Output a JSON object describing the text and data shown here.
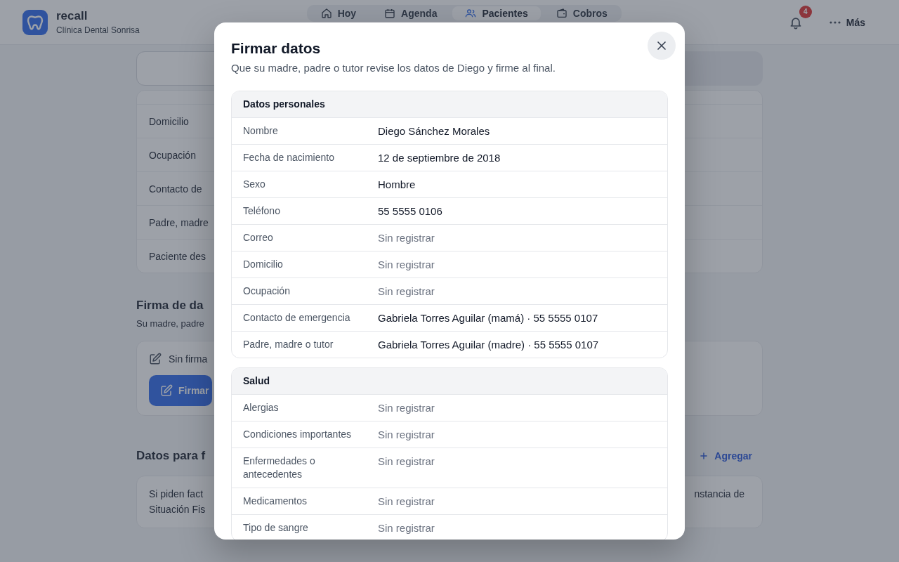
{
  "app_header": {
    "brand": "recall",
    "clinic": "Clínica Dental Sonrisa",
    "nav_tabs": [
      {
        "label": "Hoy",
        "selected": false
      },
      {
        "label": "Agenda",
        "selected": false
      },
      {
        "label": "Pacientes",
        "selected": true
      },
      {
        "label": "Cobros",
        "selected": false
      }
    ],
    "notifications_badge": "4",
    "more_label": "Más"
  },
  "background_page": {
    "info_rows": [
      "Domicilio",
      "Ocupación",
      "Contacto de",
      "Padre, madre",
      "Paciente des"
    ],
    "signature_section": {
      "title": "Firma de da",
      "subtitle": "Su madre, padre",
      "status": "Sin firma",
      "button": "Firmar"
    },
    "billing_section": {
      "title": "Datos para f",
      "add_button": "Agregar",
      "note_lines": [
        "Si piden fact",
        "Situación Fis"
      ],
      "note_right": "nstancia de"
    }
  },
  "modal": {
    "title": "Firmar datos",
    "subtitle": "Que su madre, padre o tutor revise los datos de Diego y firme al final.",
    "sections": [
      {
        "title": "Datos personales",
        "rows": [
          {
            "label": "Nombre",
            "value": "Diego Sánchez Morales",
            "missing": false
          },
          {
            "label": "Fecha de nacimiento",
            "value": "12 de septiembre de 2018",
            "missing": false
          },
          {
            "label": "Sexo",
            "value": "Hombre",
            "missing": false
          },
          {
            "label": "Teléfono",
            "value": "55 5555 0106",
            "missing": false
          },
          {
            "label": "Correo",
            "value": "Sin registrar",
            "missing": true
          },
          {
            "label": "Domicilio",
            "value": "Sin registrar",
            "missing": true
          },
          {
            "label": "Ocupación",
            "value": "Sin registrar",
            "missing": true
          },
          {
            "label": "Contacto de emergencia",
            "value": "Gabriela Torres Aguilar (mamá) · 55 5555 0107",
            "missing": false
          },
          {
            "label": "Padre, madre o tutor",
            "value": "Gabriela Torres Aguilar (madre) · 55 5555 0107",
            "missing": false
          }
        ]
      },
      {
        "title": "Salud",
        "rows": [
          {
            "label": "Alergias",
            "value": "Sin registrar",
            "missing": true
          },
          {
            "label": "Condiciones importantes",
            "value": "Sin registrar",
            "missing": true
          },
          {
            "label": "Enfermedades o antecedentes",
            "value": "Sin registrar",
            "missing": true
          },
          {
            "label": "Medicamentos",
            "value": "Sin registrar",
            "missing": true
          },
          {
            "label": "Tipo de sangre",
            "value": "Sin registrar",
            "missing": true
          }
        ]
      }
    ]
  }
}
